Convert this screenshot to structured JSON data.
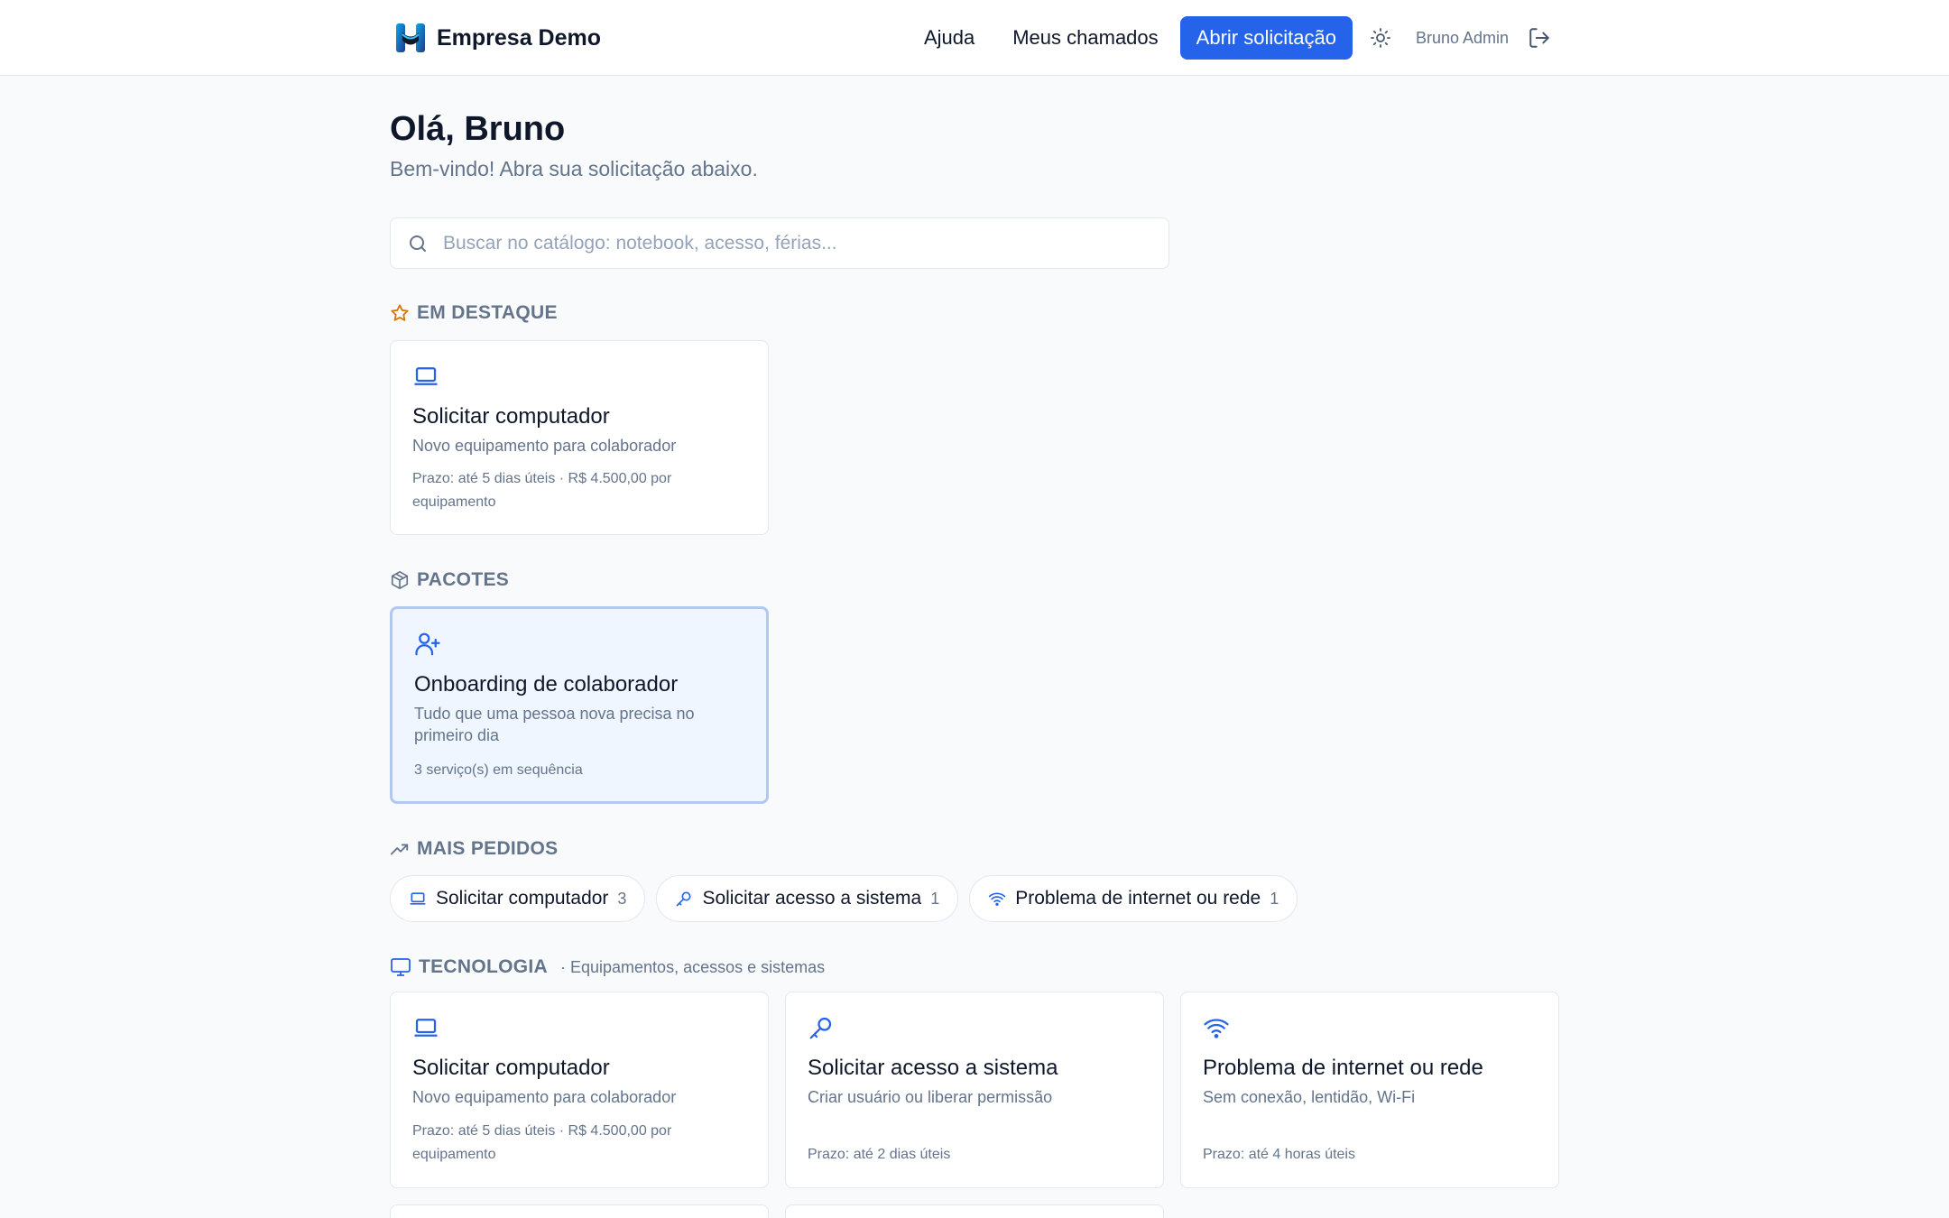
{
  "header": {
    "brand": "Empresa Demo",
    "nav": {
      "help": "Ajuda",
      "tickets": "Meus chamados"
    },
    "cta": "Abrir solicitação",
    "user": "Bruno Admin"
  },
  "main": {
    "greeting": "Olá, Bruno",
    "subtitle": "Bem-vindo! Abra sua solicitação abaixo.",
    "search_placeholder": "Buscar no catálogo: notebook, acesso, férias..."
  },
  "featured": {
    "title": "EM DESTAQUE",
    "card": {
      "icon": "laptop-icon",
      "title": "Solicitar computador",
      "description": "Novo equipamento para colaborador",
      "meta": "Prazo: até 5 dias úteis · R$ 4.500,00 por equipamento"
    }
  },
  "packages": {
    "title": "PACOTES",
    "card": {
      "icon": "user-plus-icon",
      "title": "Onboarding de colaborador",
      "description": "Tudo que uma pessoa nova precisa no primeiro dia",
      "meta": "3 serviço(s) em sequência"
    }
  },
  "popular": {
    "title": "MAIS PEDIDOS",
    "items": [
      {
        "icon": "laptop-icon",
        "label": "Solicitar computador",
        "count": "3"
      },
      {
        "icon": "key-icon",
        "label": "Solicitar acesso a sistema",
        "count": "1"
      },
      {
        "icon": "wifi-icon",
        "label": "Problema de internet ou rede",
        "count": "1"
      }
    ]
  },
  "technology": {
    "title": "TECNOLOGIA",
    "subtitle": "· Equipamentos, acessos e sistemas",
    "cards": [
      {
        "icon": "laptop-icon",
        "title": "Solicitar computador",
        "description": "Novo equipamento para colaborador",
        "meta": "Prazo: até 5 dias úteis · R$ 4.500,00 por equipamento"
      },
      {
        "icon": "key-icon",
        "title": "Solicitar acesso a sistema",
        "description": "Criar usuário ou liberar permissão",
        "meta": "Prazo: até 2 dias úteis"
      },
      {
        "icon": "wifi-icon",
        "title": "Problema de internet ou rede",
        "description": "Sem conexão, lentidão, Wi-Fi",
        "meta": "Prazo: até 4 horas úteis"
      }
    ]
  },
  "colors": {
    "accent": "#2563eb",
    "amber": "#d97706",
    "muted": "#64748b"
  }
}
